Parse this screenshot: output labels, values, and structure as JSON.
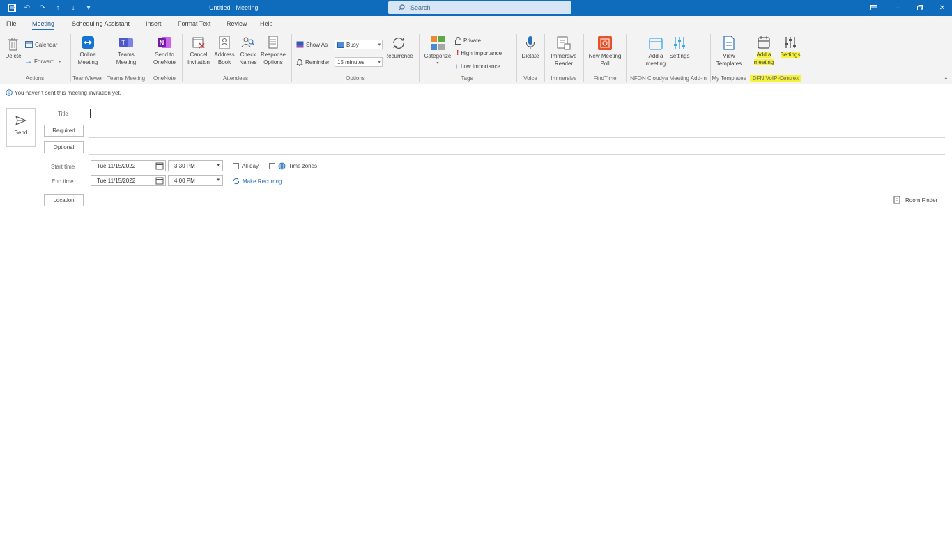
{
  "window": {
    "title": "Untitled - Meeting",
    "search_placeholder": "Search"
  },
  "quick_access": [
    "save-icon",
    "undo-icon",
    "redo-icon",
    "up-arrow-icon",
    "down-arrow-icon",
    "customize-icon"
  ],
  "menu_tabs": [
    "File",
    "Meeting",
    "Scheduling Assistant",
    "Insert",
    "Format Text",
    "Review",
    "Help"
  ],
  "active_tab": "Meeting",
  "ribbon": {
    "actions": {
      "delete": "Delete",
      "calendar": "Calendar",
      "forward": "Forward",
      "group": "Actions"
    },
    "teamviewer": {
      "button": "Online Meeting",
      "group": "TeamViewer"
    },
    "teams": {
      "button": "Teams Meeting",
      "group": "Teams Meeting"
    },
    "onenote": {
      "button": "Send to OneNote",
      "group": "OneNote"
    },
    "attendees": {
      "cancel": "Cancel Invitation",
      "address": "Address Book",
      "check": "Check Names",
      "response": "Response Options",
      "group": "Attendees"
    },
    "options": {
      "show_as_label": "Show As",
      "show_as_value": "Busy",
      "reminder_label": "Reminder",
      "reminder_value": "15 minutes",
      "recurrence": "Recurrence",
      "group": "Options"
    },
    "tags": {
      "categorize": "Categorize",
      "private": "Private",
      "high": "High Importance",
      "low": "Low Importance",
      "group": "Tags"
    },
    "voice": {
      "button": "Dictate",
      "group": "Voice"
    },
    "immersive": {
      "button": "Immersive Reader",
      "group": "Immersive"
    },
    "findtime": {
      "button": "New Meeting Poll",
      "group": "FindTime"
    },
    "nfon": {
      "add": "Add a meeting",
      "settings": "Settings",
      "group": "NFON Cloudya Meeting Add-in"
    },
    "templates": {
      "button": "View Templates",
      "group": "My Templates"
    },
    "dfn": {
      "add": "Add a meeting",
      "settings": "Settings",
      "group": "DFN VoIP-Centrex"
    },
    "highlight_color": "#f6f23a"
  },
  "info_bar": "You haven't sent this meeting invitation yet.",
  "form": {
    "send": "Send",
    "title_label": "Title",
    "required": "Required",
    "optional": "Optional",
    "start_label": "Start time",
    "end_label": "End time",
    "start_date": "Tue 11/15/2022",
    "start_time": "3:30 PM",
    "end_date": "Tue 11/15/2022",
    "end_time": "4:00 PM",
    "all_day": "All day",
    "time_zones": "Time zones",
    "make_recurring": "Make Recurring",
    "location": "Location",
    "room_finder": "Room Finder"
  },
  "colors": {
    "titlebar": "#0f6cbd",
    "accent": "#1f6fc5",
    "link": "#2a6fb8"
  }
}
